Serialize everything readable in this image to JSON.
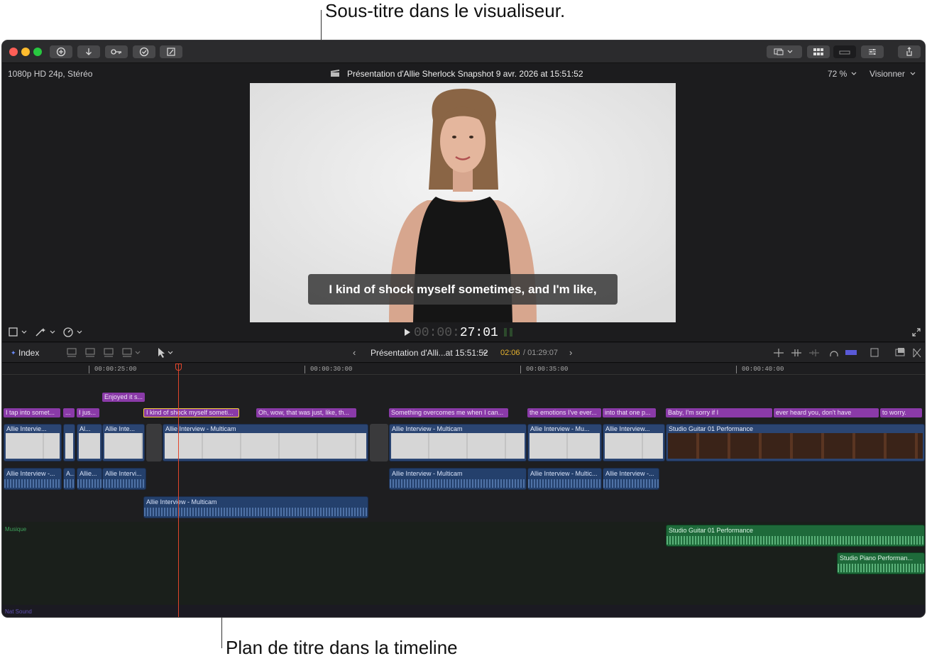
{
  "callouts": {
    "top": "Sous-titre dans le visualiseur.",
    "bottom": "Plan de titre dans la timeline"
  },
  "toolbar": {
    "icons": [
      "import-icon",
      "download-icon",
      "keyword-icon",
      "check-icon",
      "edit-icon",
      "viewer-layout-icon",
      "browser-icon",
      "timeline-icon",
      "inspector-icon",
      "share-icon"
    ]
  },
  "info": {
    "format": "1080p HD 24p, Stéréo",
    "project": "Présentation d'Allie Sherlock Snapshot 9 avr. 2026 at 15:51:52",
    "zoom": "72 %",
    "view": "Visionner"
  },
  "viewer": {
    "subtitle": "I kind of shock myself sometimes, and I'm like,",
    "timecode_dim": "00:00:",
    "timecode": "27:01"
  },
  "timeline_bar": {
    "index": "Index",
    "project": "Présentation d'Alli...at 15:51:52",
    "position": "02:06",
    "duration": "/ 01:29:07"
  },
  "ruler": {
    "ticks": [
      "00:00:25:00",
      "00:00:30:00",
      "00:00:35:00",
      "00:00:40:00"
    ]
  },
  "captions_upper": [
    {
      "text": "Enjoyed it s..."
    }
  ],
  "captions": [
    {
      "text": "I tap into somet..."
    },
    {
      "text": "..."
    },
    {
      "text": "I jus..."
    },
    {
      "text": "I kind of shock myself someti..."
    },
    {
      "text": "Oh, wow, that was just, like, th..."
    },
    {
      "text": "Something overcomes me when I can..."
    },
    {
      "text": "the emotions I've ever..."
    },
    {
      "text": "into that one p..."
    },
    {
      "text": "Baby, I'm sorry if I"
    },
    {
      "text": "ever heard you, don't have"
    },
    {
      "text": "to worry."
    }
  ],
  "video_clips": [
    {
      "label": "Allie Intervie..."
    },
    {
      "label": ""
    },
    {
      "label": "Al..."
    },
    {
      "label": "Allie Inte..."
    },
    {
      "label": "Allie Interview - Multicam"
    },
    {
      "label": "Allie Interview - Multicam"
    },
    {
      "label": "Allie Interview - Mu..."
    },
    {
      "label": "Allie Interview..."
    },
    {
      "label": "Studio Guitar 01 Performance"
    }
  ],
  "audio_clips": [
    {
      "label": "Allie Interview -..."
    },
    {
      "label": "A..."
    },
    {
      "label": "Allie..."
    },
    {
      "label": "Allie Intervi..."
    },
    {
      "label": "Allie Interview - Multicam"
    },
    {
      "label": "Allie Interview - Multic..."
    },
    {
      "label": "Allie Interview -..."
    },
    {
      "label": "Allie Interview - Multicam"
    }
  ],
  "lanes": {
    "music": "Musique",
    "nat": "Nat Sound"
  },
  "music_clips": [
    {
      "label": "Studio Guitar 01 Performance"
    },
    {
      "label": "Studio Piano Performan..."
    }
  ]
}
